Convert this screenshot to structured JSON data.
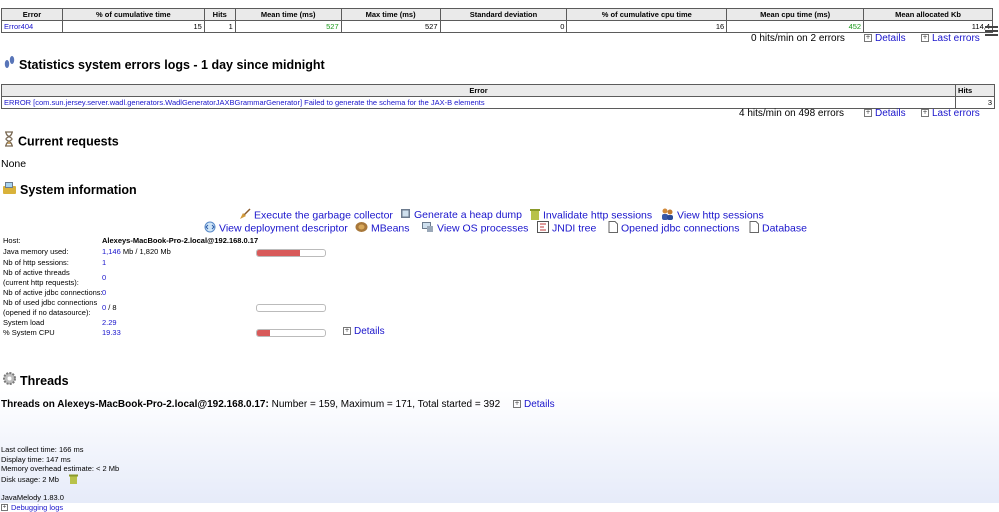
{
  "errors_table": {
    "headers": [
      "Error",
      "% of cumulative time",
      "Hits",
      "Mean time (ms)",
      "Max time (ms)",
      "Standard deviation",
      "% of cumulative cpu time",
      "Mean cpu time (ms)",
      "Mean allocated Kb"
    ],
    "row": [
      "Error404",
      "15",
      "1",
      "527",
      "527",
      "0",
      "16",
      "452",
      "114,4"
    ],
    "summary": "0 hits/min on 2 errors"
  },
  "links": {
    "details": "Details",
    "last_errors": "Last errors"
  },
  "logs": {
    "title": "Statistics system errors logs - 1 day since midnight",
    "headers": [
      "Error",
      "Hits"
    ],
    "row": [
      "ERROR [com.sun.jersey.server.wadl.generators.WadlGeneratorJAXBGrammarGenerator] Failed to generate the schema for the JAX-B elements",
      "3"
    ],
    "summary": "4 hits/min on 498 errors"
  },
  "current_requests": {
    "title": "Current requests",
    "value": "None"
  },
  "system_information": {
    "title": "System information",
    "actions_row1": [
      "Execute the garbage collector",
      "Generate a heap dump",
      "Invalidate http sessions",
      "View http sessions"
    ],
    "actions_row2": [
      "View deployment descriptor",
      "MBeans",
      "View OS processes",
      "JNDI tree",
      "Opened jdbc connections",
      "Database"
    ],
    "host_label": "Host:",
    "host_value": "Alexeys-MacBook-Pro-2.local@192.168.0.17",
    "memory_label": "Java memory used:",
    "memory_used": "1,146",
    "memory_rest": " Mb / 1,820 Mb",
    "memory_fraction": 0.63,
    "sessions_label": "Nb of http sessions:",
    "sessions_value": "1",
    "threads_label_1": "Nb of active threads",
    "threads_label_2": "(current http requests):",
    "threads_value": "0",
    "jdbc_label": "Nb of active jdbc connections:",
    "jdbc_value": "0",
    "used_jdbc_label_1": "Nb of used jdbc connections",
    "used_jdbc_label_2": "(opened if no datasource):",
    "used_jdbc_value": "0",
    "used_jdbc_rest": " / 8",
    "used_jdbc_fraction": 0.0,
    "load_label": "System load",
    "load_value": "2.29",
    "cpu_label": "% System CPU",
    "cpu_value": "19.33",
    "cpu_fraction": 0.19
  },
  "threads": {
    "title": "Threads",
    "summary_bold": "Threads on Alexeys-MacBook-Pro-2.local@192.168.0.17:",
    "summary_rest": " Number = 159, Maximum = 171, Total started = 392"
  },
  "footer": {
    "collect_time": "Last collect time: 166 ms",
    "display_time": "Display time: 147 ms",
    "overhead": "Memory overhead estimate: < 2 Mb",
    "disk_usage": "Disk usage: 2 Mb",
    "version": "JavaMelody 1.83.0",
    "debug_logs": "Debugging logs"
  },
  "icons": {
    "statistics": "footprints-icon",
    "current_requests": "hourglass-icon",
    "system_information": "computer-icon",
    "threads": "gear-icon",
    "menu": "hamburger-menu-icon"
  }
}
